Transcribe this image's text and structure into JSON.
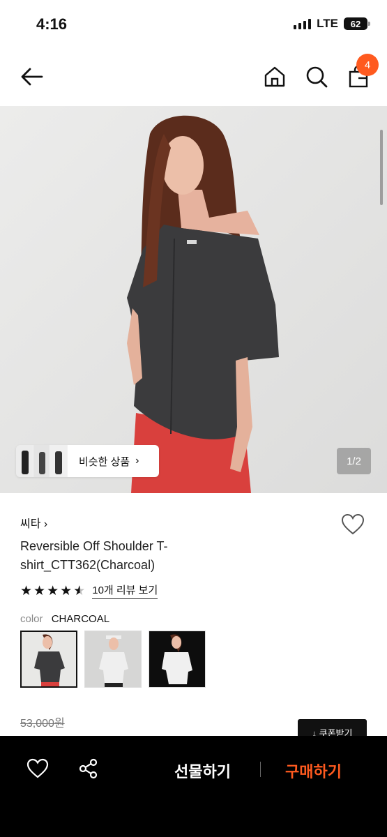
{
  "status": {
    "time": "4:16",
    "network": "LTE",
    "battery": "62"
  },
  "nav": {
    "cart_count": "4"
  },
  "hero": {
    "similar_label": "비슷한 상품",
    "image_counter": "1/2"
  },
  "product": {
    "brand": "씨타",
    "title": "Reversible Off Shoulder T-shirt_CTT362(Charcoal)",
    "rating": 4.5,
    "review_link": "10개 리뷰 보기",
    "color_key": "color",
    "color_value": "CHARCOAL",
    "original_price": "53,000원",
    "coupon_label": "↓ 쿠폰받기"
  },
  "bottom_bar": {
    "gift_label": "선물하기",
    "buy_label": "구매하기"
  },
  "colors": {
    "accent": "#ff5a1f",
    "bottom_bg": "#000000"
  },
  "icons": [
    "back-arrow-icon",
    "home-icon",
    "search-icon",
    "shopping-bag-icon",
    "heart-icon",
    "share-icon",
    "chevron-right-icon",
    "star-icon"
  ]
}
